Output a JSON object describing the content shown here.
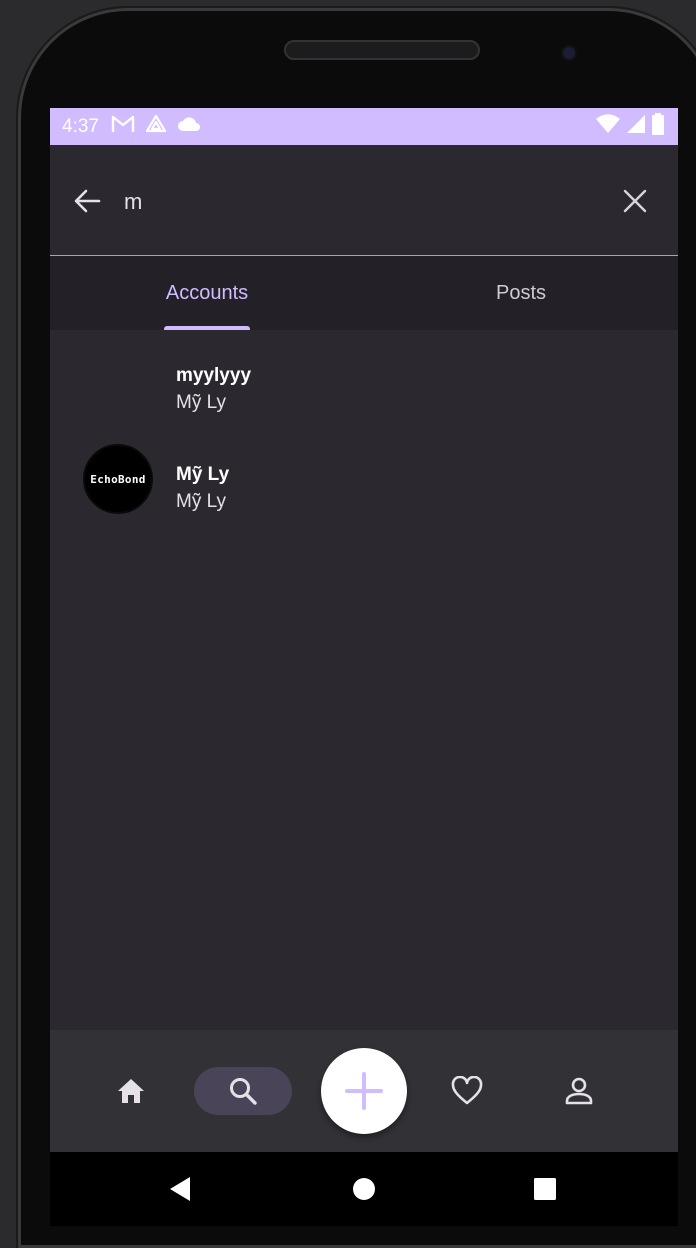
{
  "status_bar": {
    "time": "4:37",
    "left_icons": [
      "gmail-icon",
      "drive-icon",
      "cloud-icon"
    ],
    "right_icons": [
      "wifi-icon",
      "signal-icon",
      "battery-icon"
    ],
    "background": "#d0bcff"
  },
  "search": {
    "query": "m"
  },
  "tabs": [
    {
      "label": "Accounts",
      "selected": true
    },
    {
      "label": "Posts",
      "selected": false
    }
  ],
  "results": [
    {
      "username": "myylyyy",
      "name": "Mỹ Ly",
      "avatar": null
    },
    {
      "username": "Mỹ Ly",
      "name": "Mỹ Ly",
      "avatar_text": "EchoBond"
    }
  ],
  "bottom_nav": {
    "items": [
      "home-icon",
      "search-icon",
      "add-icon",
      "heart-icon",
      "profile-icon"
    ],
    "active": "search-icon"
  },
  "colors": {
    "accent": "#d0bcff",
    "surface": "#2b292f",
    "tab_bar": "#232127",
    "nav_bar": "#323136",
    "active_pill": "#4a4458"
  }
}
